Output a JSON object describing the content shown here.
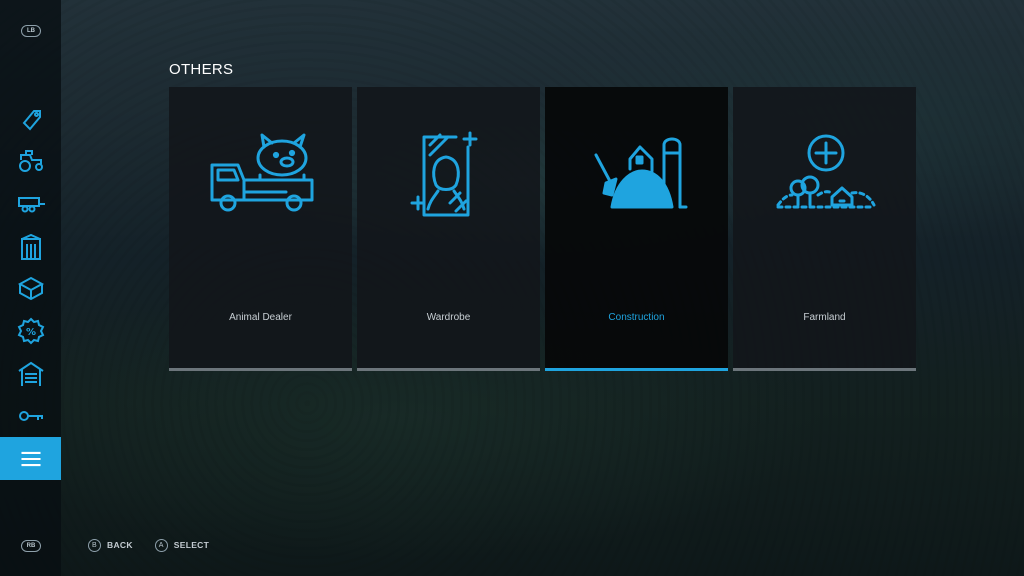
{
  "sidebar": {
    "top_bumper": "LB",
    "bottom_bumper": "RB",
    "items": [
      {
        "icon": "price-tag-icon"
      },
      {
        "icon": "tractor-icon"
      },
      {
        "icon": "trailer-icon"
      },
      {
        "icon": "silo-building-icon"
      },
      {
        "icon": "box-icon"
      },
      {
        "icon": "sale-percent-icon"
      },
      {
        "icon": "garage-icon"
      },
      {
        "icon": "key-icon"
      },
      {
        "icon": "menu-icon",
        "active": true
      }
    ]
  },
  "main": {
    "section_title": "OTHERS",
    "cards": [
      {
        "label": "Animal Dealer",
        "icon": "animal-dealer-icon"
      },
      {
        "label": "Wardrobe",
        "icon": "wardrobe-icon"
      },
      {
        "label": "Construction",
        "icon": "construction-icon",
        "selected": true
      },
      {
        "label": "Farmland",
        "icon": "farmland-icon"
      }
    ]
  },
  "footer": {
    "back": {
      "glyph": "B",
      "label": "BACK"
    },
    "select": {
      "glyph": "A",
      "label": "SELECT"
    }
  },
  "colors": {
    "accent": "#1fa4df",
    "inactive_bar": "#6c757b"
  }
}
